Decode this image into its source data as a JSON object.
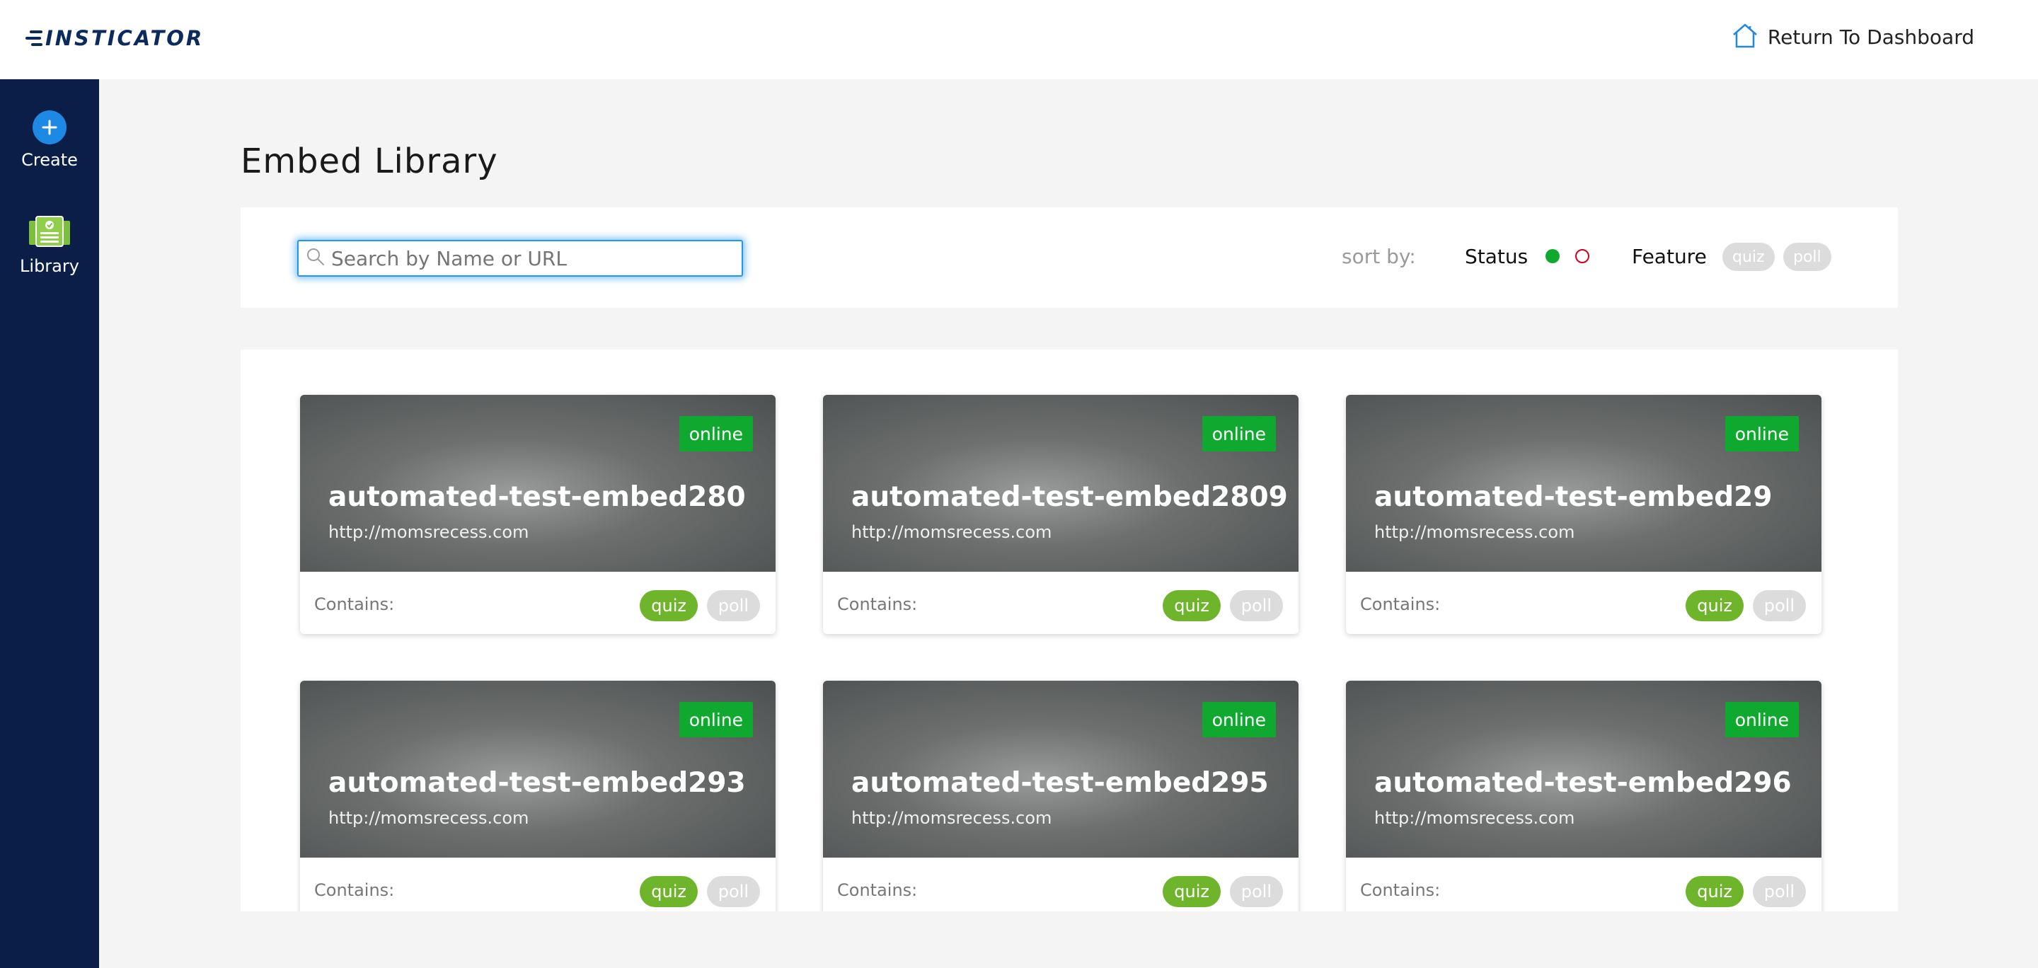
{
  "app": {
    "logo_text": "INSTICATOR"
  },
  "header": {
    "return_label": "Return To Dashboard"
  },
  "sidebar": {
    "items": [
      {
        "label": "Create",
        "icon": "plus-circle-icon"
      },
      {
        "label": "Library",
        "icon": "library-icon"
      }
    ]
  },
  "page": {
    "title": "Embed Library"
  },
  "filters": {
    "search_placeholder": "Search by Name or URL",
    "search_value": "",
    "sort_by_label": "sort by:",
    "status_label": "Status",
    "feature_label": "Feature",
    "feature_options": [
      "quiz",
      "poll"
    ],
    "colors": {
      "online": "#10a92f",
      "offline": "#d0021b",
      "focus": "#2196f3"
    }
  },
  "embeds": [
    {
      "name": "automated-test-embed280",
      "url": "http://momsrecess.com",
      "status": "online",
      "contains_label": "Contains:",
      "features": [
        "quiz",
        "poll"
      ]
    },
    {
      "name": "automated-test-embed2809",
      "url": "http://momsrecess.com",
      "status": "online",
      "contains_label": "Contains:",
      "features": [
        "quiz",
        "poll"
      ]
    },
    {
      "name": "automated-test-embed29",
      "url": "http://momsrecess.com",
      "status": "online",
      "contains_label": "Contains:",
      "features": [
        "quiz",
        "poll"
      ]
    },
    {
      "name": "automated-test-embed293",
      "url": "http://momsrecess.com",
      "status": "online",
      "contains_label": "Contains:",
      "features": [
        "quiz",
        "poll"
      ]
    },
    {
      "name": "automated-test-embed295",
      "url": "http://momsrecess.com",
      "status": "online",
      "contains_label": "Contains:",
      "features": [
        "quiz",
        "poll"
      ]
    },
    {
      "name": "automated-test-embed296",
      "url": "http://momsrecess.com",
      "status": "online",
      "contains_label": "Contains:",
      "features": [
        "quiz",
        "poll"
      ]
    }
  ]
}
